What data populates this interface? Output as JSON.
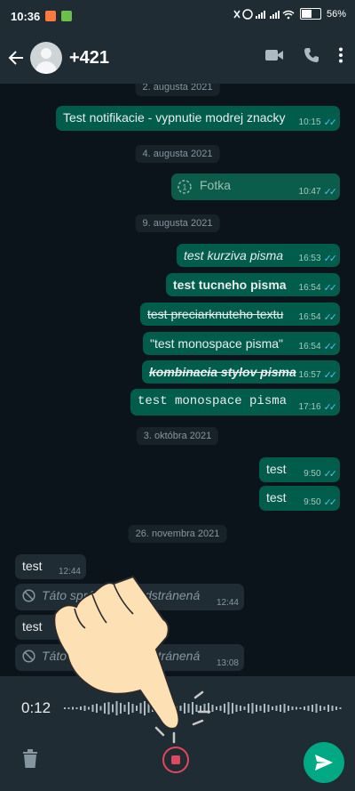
{
  "status": {
    "time": "10:36",
    "battery": "56"
  },
  "header": {
    "title": "+421"
  },
  "colors": {
    "header": "#1f2c34",
    "outgoing": "#005c4b",
    "incoming": "#202c33",
    "accent": "#00a884",
    "ticks": "#53bdeb",
    "record": "#e0485e"
  },
  "chat": {
    "dates": [
      "2. augusta 2021",
      "4. augusta 2021",
      "9. augusta 2021",
      "3. októbra 2021",
      "26. novembra 2021"
    ],
    "messages": [
      {
        "text": "Test notifikacie - vypnutie modrej znacky",
        "time": "10:15"
      },
      {
        "text": "Fotka",
        "time": "10:47"
      },
      {
        "text": "test kurziva pisma",
        "time": "16:53"
      },
      {
        "text": "test tucneho pisma",
        "time": "16:54"
      },
      {
        "text": "test preciarknuteho textu",
        "time": "16:54"
      },
      {
        "text": "\"test monospace pisma\"",
        "time": "16:54"
      },
      {
        "text": "kombinacia stylov pisma",
        "time": "16:57"
      },
      {
        "text": "test monospace pisma",
        "time": "17:16"
      },
      {
        "text": "test",
        "time": "9:50"
      },
      {
        "text": "test",
        "time": "9:50"
      },
      {
        "text": "test",
        "time": "12:44"
      },
      {
        "text": "Táto správa bola odstránená",
        "time": "12:44"
      },
      {
        "text": "test",
        "time": ""
      },
      {
        "text": "Táto správa bola odstránená",
        "time": "13:08"
      }
    ]
  },
  "recording": {
    "elapsed": "0:12"
  },
  "icons": {
    "back": "arrow-left-icon",
    "video": "video-call-icon",
    "call": "phone-icon",
    "menu": "more-vert-icon",
    "trash": "trash-icon",
    "stop": "stop-record-icon",
    "send": "send-icon",
    "deleted": "blocked-icon"
  }
}
